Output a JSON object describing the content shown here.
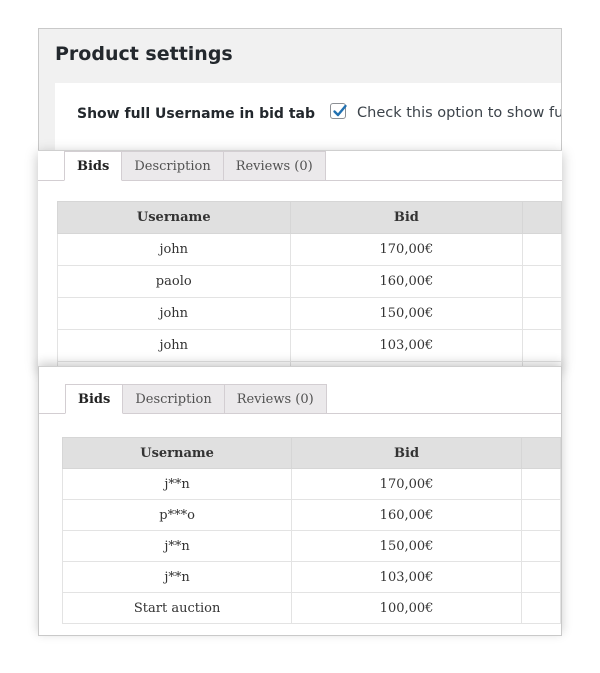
{
  "settings": {
    "title": "Product settings",
    "option_label": "Show full Username in bid tab",
    "checkbox_text": "Check this option to show ful",
    "checked": true,
    "accent_color": "#2271b1"
  },
  "full_view": {
    "tabs": [
      {
        "label": "Bids",
        "active": true
      },
      {
        "label": "Description",
        "active": false
      },
      {
        "label": "Reviews (0)",
        "active": false
      }
    ],
    "columns": [
      "Username",
      "Bid",
      ""
    ],
    "rows": [
      {
        "username": "john",
        "bid": "170,00€"
      },
      {
        "username": "paolo",
        "bid": "160,00€"
      },
      {
        "username": "john",
        "bid": "150,00€"
      },
      {
        "username": "john",
        "bid": "103,00€"
      }
    ]
  },
  "masked_view": {
    "tabs": [
      {
        "label": "Bids",
        "active": true
      },
      {
        "label": "Description",
        "active": false
      },
      {
        "label": "Reviews (0)",
        "active": false
      }
    ],
    "columns": [
      "Username",
      "Bid",
      ""
    ],
    "rows": [
      {
        "username": "j**n",
        "bid": "170,00€"
      },
      {
        "username": "p***o",
        "bid": "160,00€"
      },
      {
        "username": "j**n",
        "bid": "150,00€"
      },
      {
        "username": "j**n",
        "bid": "103,00€"
      },
      {
        "username": "Start auction",
        "bid": "100,00€"
      }
    ]
  }
}
